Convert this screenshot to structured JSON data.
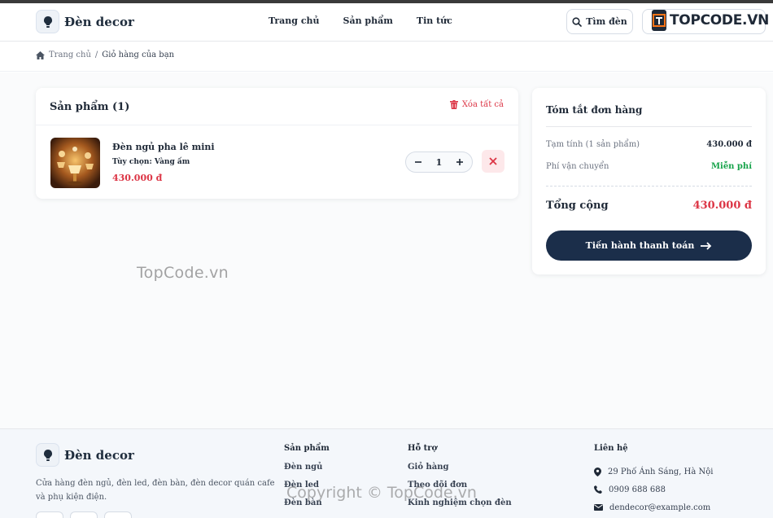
{
  "brand": {
    "name": "Đèn decor"
  },
  "nav": {
    "items": [
      "Trang chủ",
      "Sản phẩm",
      "Tin tức"
    ]
  },
  "header": {
    "search_label": "Tìm đèn"
  },
  "watermark_logo": {
    "text": "TOPCODE.VN"
  },
  "breadcrumb": {
    "home": "Trang chủ",
    "separator": "/",
    "current": "Giỏ hàng của bạn"
  },
  "cart": {
    "title": "Sản phẩm (1)",
    "clear_label": "Xóa tất cả",
    "items": [
      {
        "name": "Đèn ngủ pha lê mini",
        "option": "Tùy chọn: Vàng ấm",
        "price": "430.000 đ",
        "quantity": "1"
      }
    ]
  },
  "summary": {
    "title": "Tóm tắt đơn hàng",
    "subtotal_label": "Tạm tính (1 sản phẩm)",
    "subtotal_value": "430.000 đ",
    "shipping_label": "Phí vận chuyển",
    "shipping_value": "Miễn phí",
    "total_label": "Tổng cộng",
    "total_value": "430.000 đ",
    "checkout_label": "Tiến hành thanh toán"
  },
  "watermarks": {
    "center": "TopCode.vn",
    "bottom": "Copyright © TopCode.vn"
  },
  "footer": {
    "brand": "Đèn decor",
    "description": "Cửa hàng đèn ngủ, đèn led, đèn bàn, đèn decor quán cafe và phụ kiện điện.",
    "products": {
      "heading": "Sản phẩm",
      "links": [
        "Đèn ngủ",
        "Đèn led",
        "Đèn bàn"
      ]
    },
    "support": {
      "heading": "Hỗ trợ",
      "links": [
        "Giỏ hàng",
        "Theo dõi đơn",
        "Kinh nghiệm chọn đèn"
      ]
    },
    "contact": {
      "heading": "Liên hệ",
      "address": "29 Phố Ánh Sáng, Hà Nội",
      "phone": "0909 688 688",
      "email": "dendecor@example.com"
    }
  },
  "colors": {
    "primary": "#1b2e4a",
    "price": "#dc3545",
    "free": "#16a34a",
    "danger_bg": "#fde8ea"
  }
}
